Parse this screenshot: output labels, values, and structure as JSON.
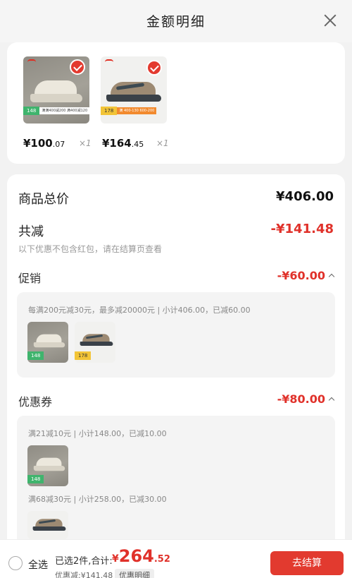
{
  "header": {
    "title": "金额明细"
  },
  "products": [
    {
      "badge_num": "148",
      "badge_text": "满满400减200 满400减120",
      "price_int": "¥100",
      "price_dec": ".07",
      "qty": "×1"
    },
    {
      "badge_num": "178",
      "badge_text": "满 400-130  600-200",
      "price_int": "¥164",
      "price_dec": ".45",
      "qty": "×1"
    }
  ],
  "summary": {
    "total_label": "商品总价",
    "total_value": "¥406.00",
    "discount_label": "共减",
    "discount_value": "-¥141.48",
    "hint": "以下优惠不包含红包，请在结算页查看"
  },
  "promotion": {
    "label": "促销",
    "value": "-¥60.00",
    "rule": "每满200元减30元，最多减20000元 | 小计406.00，已减60.00",
    "badge_nums": [
      "148",
      "178"
    ]
  },
  "coupon": {
    "label": "优惠券",
    "value": "-¥80.00",
    "rule1": "满21减10元 | 小计148.00，已减10.00",
    "rule2": "满68减30元 | 小计258.00，已减30.00",
    "badge_num": "148"
  },
  "bottom_bar": {
    "select_all": "全选",
    "selected_text": "已选2件,合计:",
    "total_cur": "¥",
    "total_int": "264",
    "total_dec": ".52",
    "saved_text": "优惠减:¥141.48",
    "detail_button": "优惠明细",
    "checkout_button": "去结算"
  },
  "colors": {
    "accent_red": "#e0312a",
    "check_red": "#e33a2f",
    "badge_green": "#3fb46d",
    "badge_yellow": "#f2c437"
  }
}
